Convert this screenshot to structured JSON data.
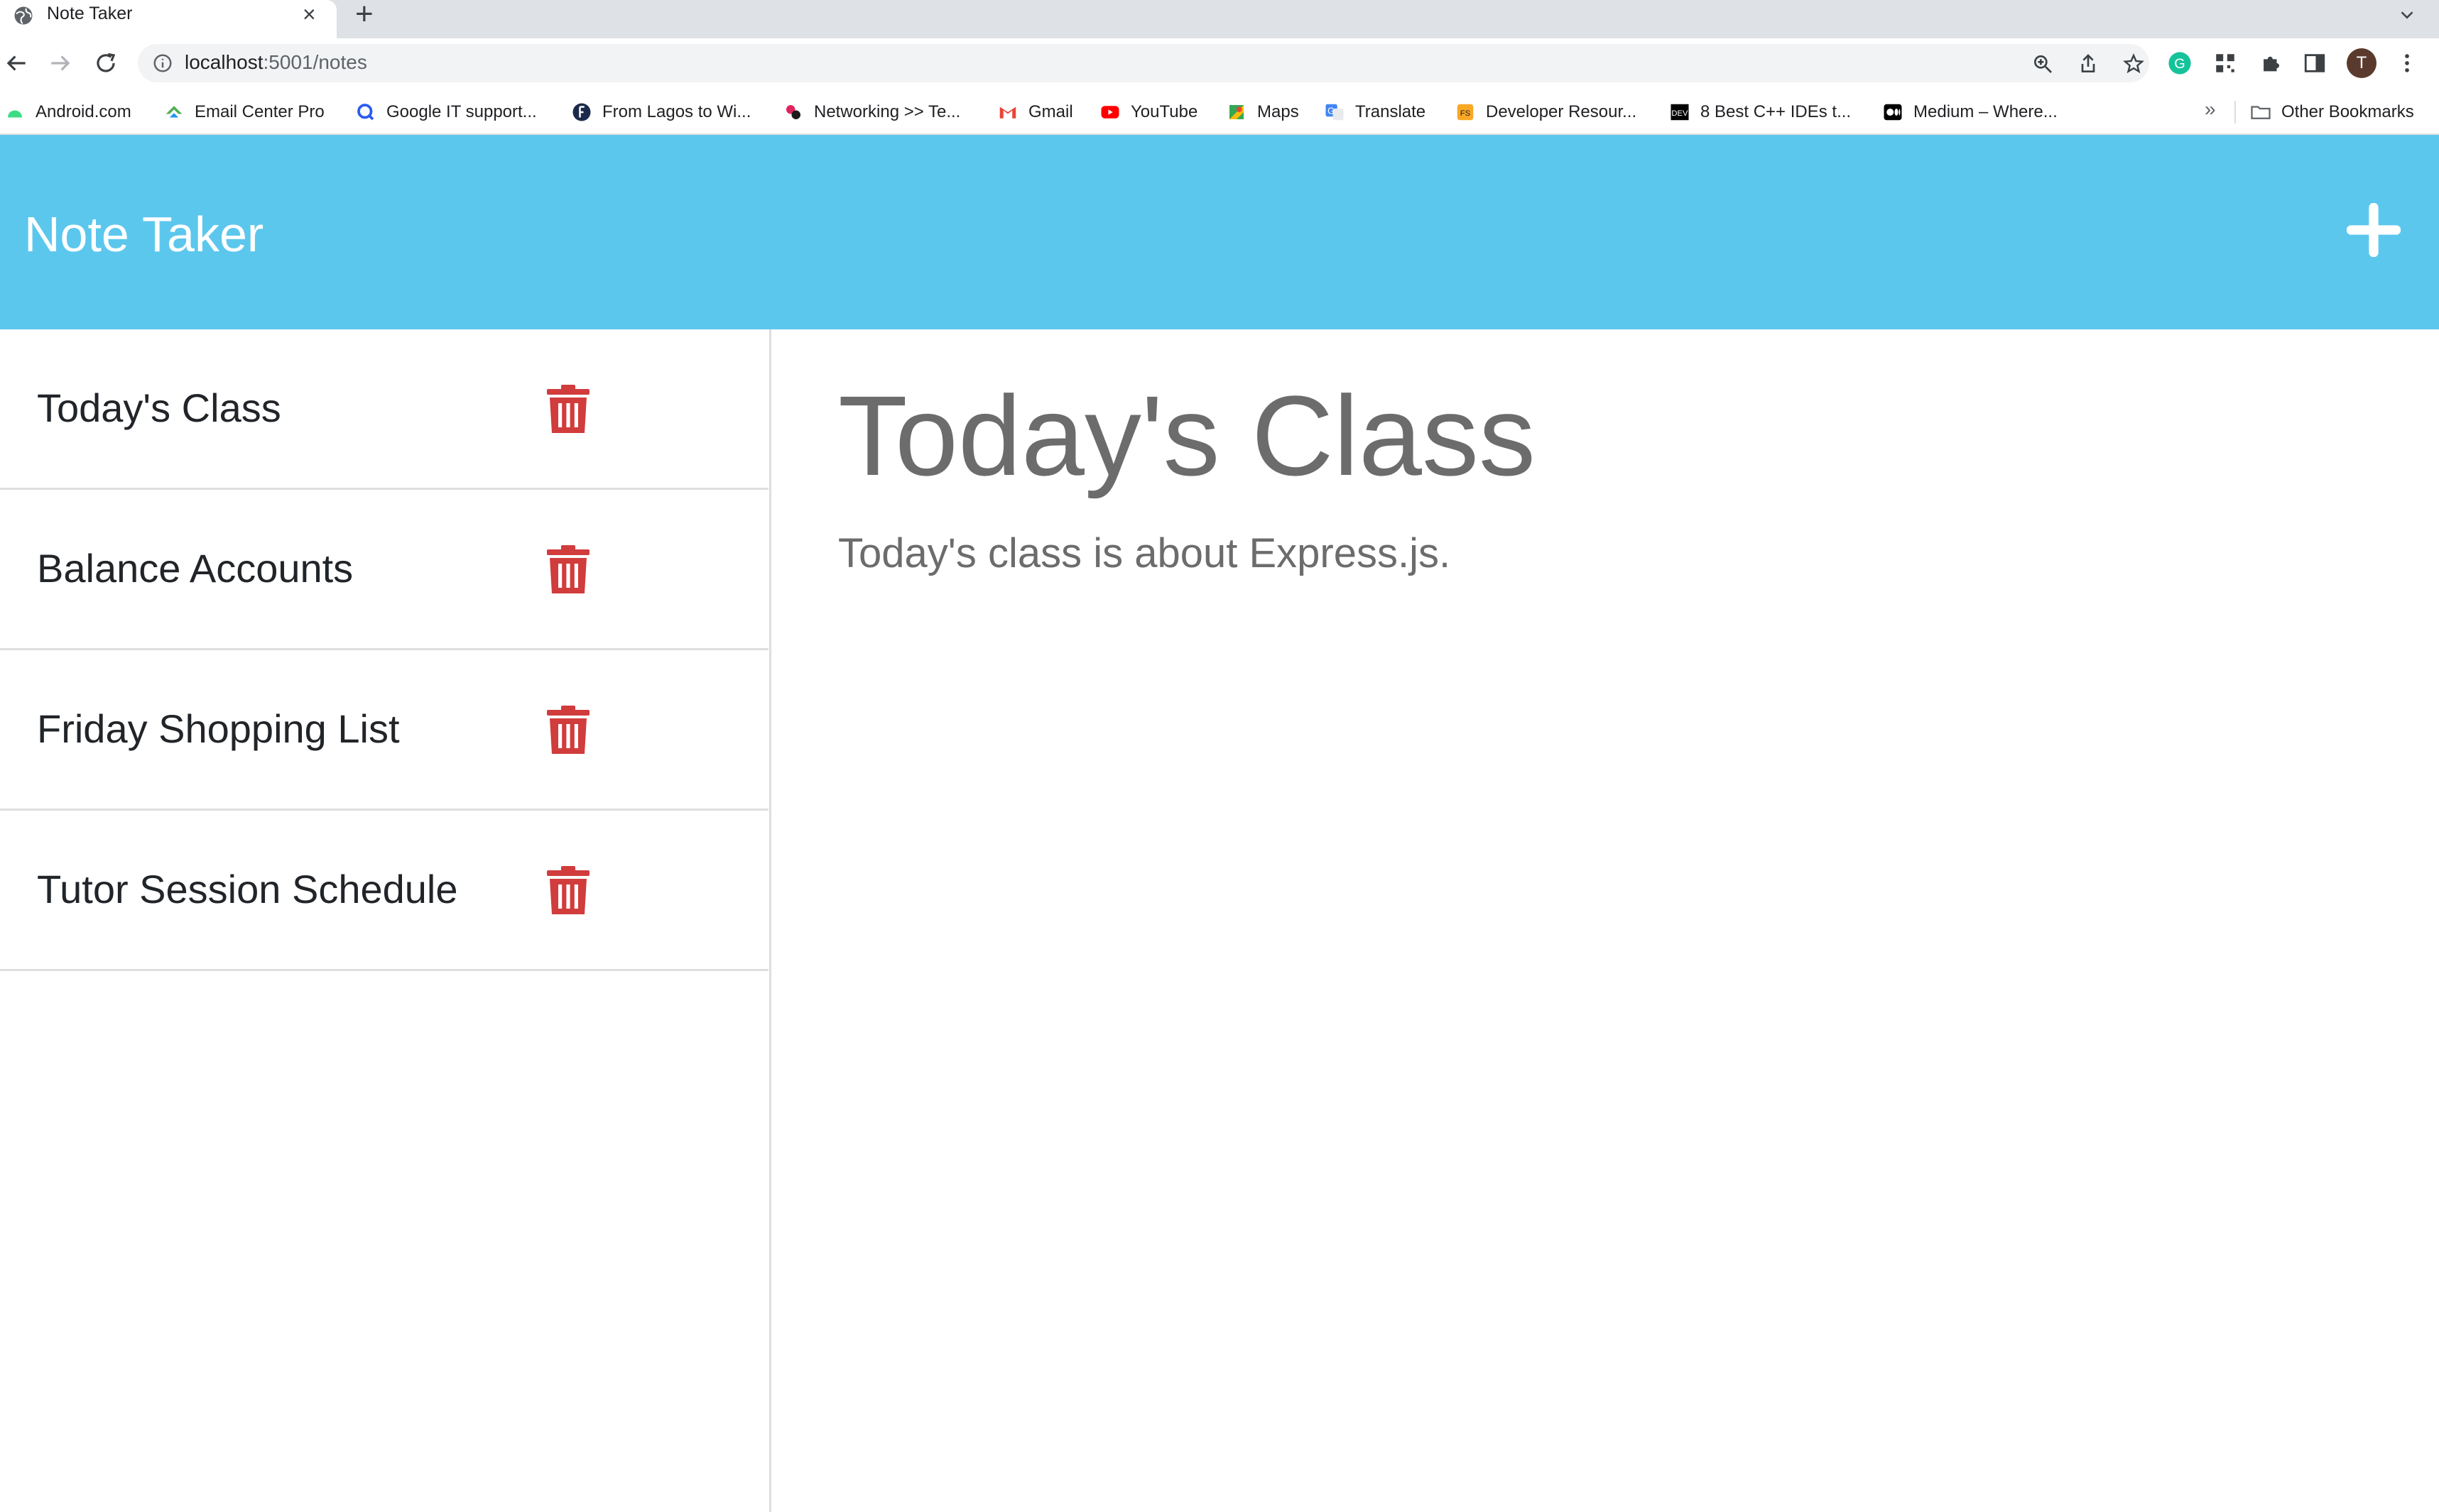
{
  "browser": {
    "tab_title": "Note Taker",
    "url_host": "localhost",
    "url_path": ":5001/notes",
    "avatar_initial": "T",
    "bookmarks": [
      {
        "label": "Android.com",
        "icon": "android-icon"
      },
      {
        "label": "Email Center Pro",
        "icon": "email-center-icon"
      },
      {
        "label": "Google IT support...",
        "icon": "google-it-icon"
      },
      {
        "label": "From Lagos to Wi...",
        "icon": "lagos-icon"
      },
      {
        "label": "Networking >> Te...",
        "icon": "networking-icon"
      },
      {
        "label": "Gmail",
        "icon": "gmail-icon"
      },
      {
        "label": "YouTube",
        "icon": "youtube-icon"
      },
      {
        "label": "Maps",
        "icon": "maps-icon"
      },
      {
        "label": "Translate",
        "icon": "translate-icon"
      },
      {
        "label": "Developer Resour...",
        "icon": "developer-icon"
      },
      {
        "label": "8 Best C++ IDEs t...",
        "icon": "dev-icon"
      },
      {
        "label": "Medium – Where...",
        "icon": "medium-icon"
      }
    ],
    "more_bookmarks": "»",
    "other_bookmarks": "Other Bookmarks"
  },
  "app": {
    "title": "Note Taker",
    "new_note_icon": "plus-icon",
    "notes": [
      {
        "title": "Today's Class"
      },
      {
        "title": "Balance Accounts"
      },
      {
        "title": "Friday Shopping List"
      },
      {
        "title": "Tutor Session Schedule"
      }
    ],
    "delete_icon": "trash-icon",
    "delete_color": "#d13c3c",
    "accent_color": "#5cc7ed",
    "active_note": {
      "title": "Today's Class",
      "text": "Today's class is about Express.js."
    }
  }
}
